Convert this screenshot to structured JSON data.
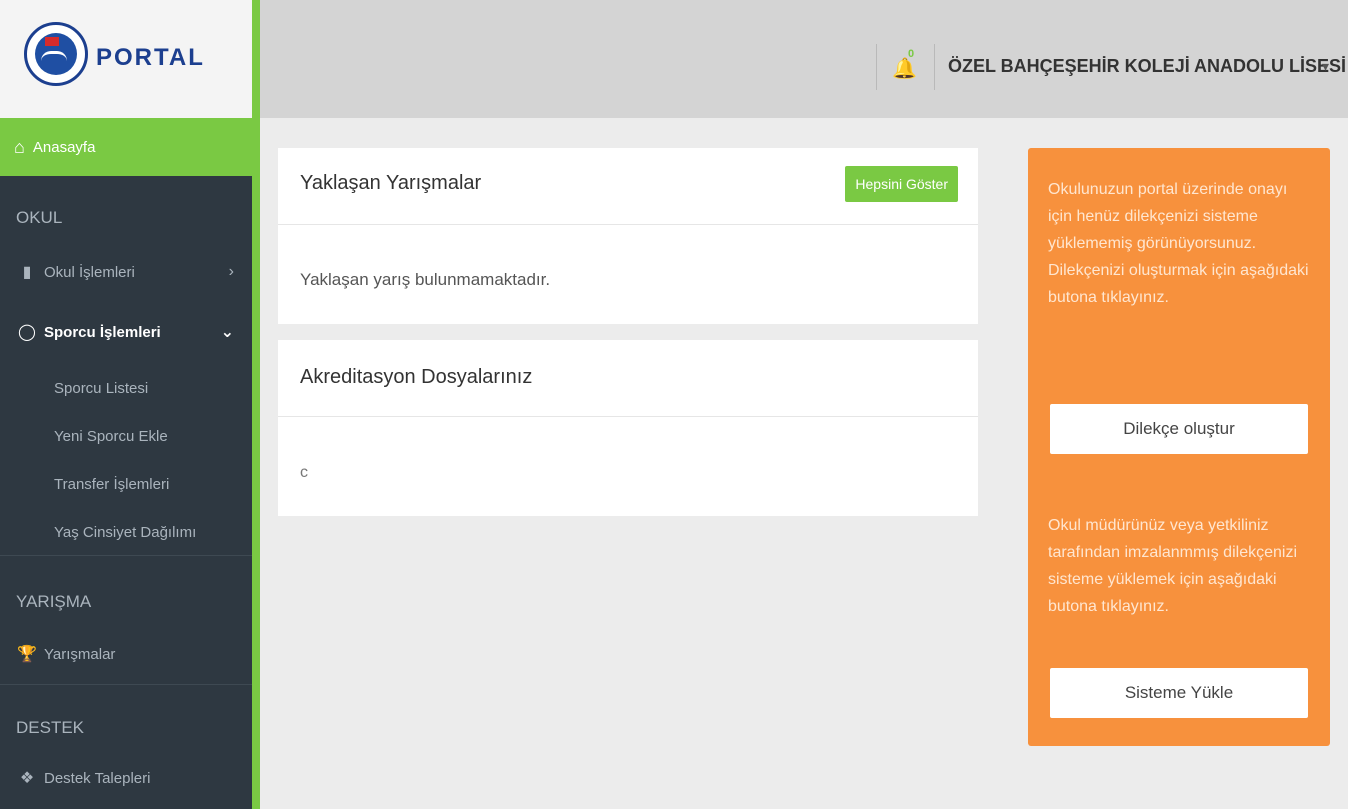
{
  "logo": {
    "text": "PORTAL",
    "icon": "federation-emblem"
  },
  "sidebar": {
    "home": {
      "label": "Anasayfa",
      "icon": "home-icon"
    },
    "sections": [
      {
        "title": "OKUL"
      },
      {
        "title": "YARIŞMA"
      },
      {
        "title": "DESTEK"
      }
    ],
    "items": [
      {
        "label": "Okul İşlemleri",
        "icon": "file-icon",
        "chevron": "›"
      },
      {
        "label": "Sporcu İşlemleri",
        "icon": "user-icon",
        "chevron": "⌄"
      },
      {
        "label": "Yarışmalar",
        "icon": "trophy-icon"
      },
      {
        "label": "Destek Talepleri",
        "icon": "ticket-icon"
      }
    ],
    "sub_items": [
      {
        "label": "Sporcu Listesi"
      },
      {
        "label": "Yeni Sporcu Ekle"
      },
      {
        "label": "Transfer İşlemleri"
      },
      {
        "label": "Yaş Cinsiyet Dağılımı"
      }
    ]
  },
  "header": {
    "notification_count": "0",
    "school_name": "ÖZEL BAHÇEŞEHİR KOLEJİ ANADOLU LİSESİ",
    "caret": "▾"
  },
  "cards": {
    "upcoming": {
      "title": "Yaklaşan Yarışmalar",
      "button": "Hepsini Göster",
      "empty_text": "Yaklaşan yarış bulunmamaktadır."
    },
    "accreditation": {
      "title": "Akreditasyon Dosyalarınız",
      "body": "c"
    }
  },
  "notice": {
    "text1": "Okulunuzun portal üzerinde onayı için henüz dilekçenizi sisteme yüklememiş görünüyorsunuz. Dilekçenizi oluşturmak için aşağıdaki butona tıklayınız.",
    "button1": "Dilekçe oluştur",
    "text2": "Okul müdürünüz veya yetkiliniz tarafından imzalanmmış dilekçenizi sisteme yüklemek için aşağıdaki butona tıklayınız.",
    "button2": "Sisteme Yükle"
  },
  "colors": {
    "accent_green": "#7ac943",
    "sidebar_bg": "#2e3841",
    "notice_orange": "#f7913d"
  }
}
